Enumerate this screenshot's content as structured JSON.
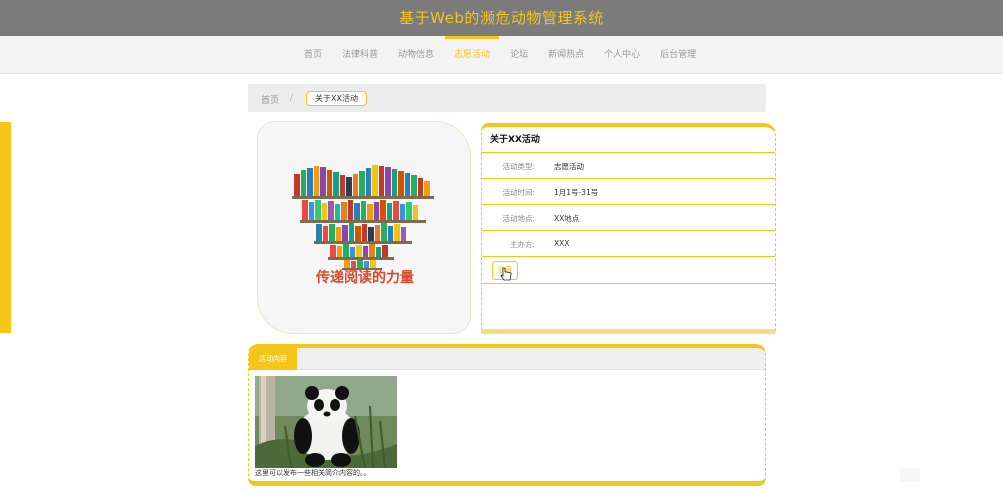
{
  "header": {
    "title": "基于Web的濒危动物管理系统"
  },
  "nav": {
    "items": [
      {
        "label": "首页",
        "active": false
      },
      {
        "label": "法律科普",
        "active": false
      },
      {
        "label": "动物信息",
        "active": false
      },
      {
        "label": "志愿活动",
        "active": true
      },
      {
        "label": "论坛",
        "active": false
      },
      {
        "label": "新闻热点",
        "active": false
      },
      {
        "label": "个人中心",
        "active": false
      },
      {
        "label": "后台管理",
        "active": false
      }
    ]
  },
  "breadcrumb": {
    "home": "首页",
    "separator": "/",
    "current": "关于XX活动"
  },
  "cover": {
    "slogan": "传递阅读的力量"
  },
  "info": {
    "title": "关于XX活动",
    "rows": [
      {
        "label": "活动类型:",
        "value": "志愿活动"
      },
      {
        "label": "活动时间:",
        "value": "1月1号-31号"
      },
      {
        "label": "活动地点:",
        "value": "XX地点"
      },
      {
        "label": "主办方:",
        "value": "XXX"
      }
    ],
    "favorite_label": "收藏"
  },
  "content": {
    "tab_label": "活动内容",
    "text": "这里可以发布一些相关简介内容的。。"
  },
  "colors": {
    "accent": "#f5c518",
    "header_bg": "#7b7b7b"
  },
  "icons": [
    "pointer-cursor-icon"
  ]
}
